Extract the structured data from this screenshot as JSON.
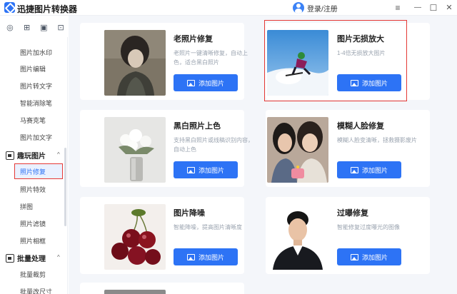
{
  "app": {
    "title": "迅捷图片转换器",
    "accent": "#2d73f5",
    "highlight": "#e53935"
  },
  "header": {
    "user_label": "登录/注册",
    "menu_icon": "≡",
    "minimize_icon": "—",
    "maximize_icon": "☐",
    "close_icon": "✕"
  },
  "rail": {
    "icons": [
      "◎",
      "⊞",
      "▣",
      "⊡"
    ]
  },
  "sidebar": {
    "items_top": [
      "图片加水印",
      "图片编辑",
      "图片转文字",
      "智能消除笔",
      "马赛克笔",
      "图片加文字"
    ],
    "section_fun": {
      "label": "趣玩图片",
      "caret": "^"
    },
    "items_fun": [
      "照片修复",
      "照片特效",
      "拼图",
      "照片滤镜",
      "照片相框"
    ],
    "section_batch": {
      "label": "批量处理",
      "caret": "^"
    },
    "items_batch": [
      "批量裁剪",
      "批量改尺寸"
    ]
  },
  "cards": [
    {
      "title": "老照片修复",
      "desc": "老照片一键清晰修复，自动上色，适合黑白照片",
      "button": "添加图片"
    },
    {
      "title": "图片无损放大",
      "desc": "1-4倍无损放大图片",
      "button": "添加图片"
    },
    {
      "title": "黑白照片上色",
      "desc": "支持黑白照片或线稿识别内容，自动上色",
      "button": "添加图片"
    },
    {
      "title": "模糊人脸修复",
      "desc": "模糊人脸变清晰，拯救摄影废片",
      "button": "添加图片"
    },
    {
      "title": "图片降噪",
      "desc": "智能降噪，提高图片清晰度",
      "button": "添加图片"
    },
    {
      "title": "过曝修复",
      "desc": "智能修复过度曝光的图像",
      "button": "添加图片"
    }
  ]
}
